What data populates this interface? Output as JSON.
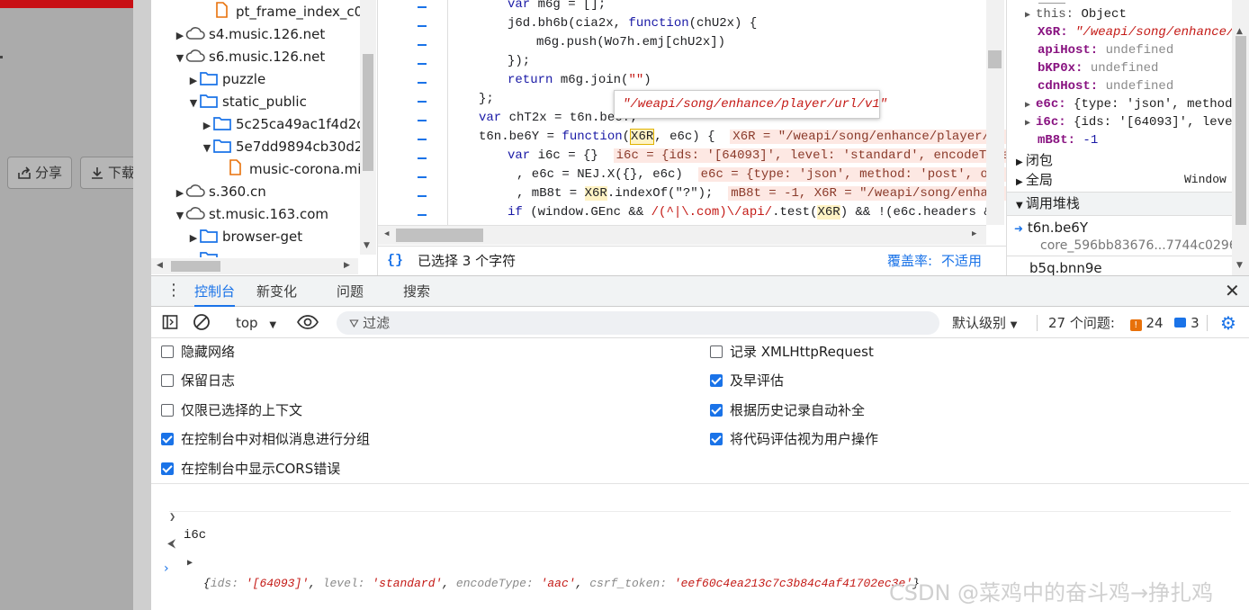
{
  "page": {
    "share_label": "分享",
    "download_label": "下载"
  },
  "tree": {
    "items": [
      {
        "label": "pt_frame_index_c0",
        "kind": "file",
        "expanded": false
      },
      {
        "label": "s4.music.126.net",
        "kind": "domain",
        "expanded": false
      },
      {
        "label": "s6.music.126.net",
        "kind": "domain",
        "expanded": true
      },
      {
        "label": "puzzle",
        "kind": "folder",
        "expanded": false
      },
      {
        "label": "static_public",
        "kind": "folder",
        "expanded": true
      },
      {
        "label": "5c25ca49ac1f4d2d",
        "kind": "folder",
        "expanded": false
      },
      {
        "label": "5e7dd9894cb30d2",
        "kind": "folder",
        "expanded": true
      },
      {
        "label": "music-corona.mi",
        "kind": "file",
        "expanded": false
      },
      {
        "label": "s.360.cn",
        "kind": "domain",
        "expanded": false
      },
      {
        "label": "st.music.163.com",
        "kind": "domain",
        "expanded": true
      },
      {
        "label": "browser-get",
        "kind": "folder",
        "expanded": false
      },
      {
        "label": "...",
        "kind": "folder",
        "expanded": false
      }
    ]
  },
  "code": {
    "tooltip": "\"/weapi/song/enhance/player/url/v1\"",
    "lines": {
      "l1a": "var ",
      "l1b": "m6g = [];",
      "l2a": "j6d.bh6b(cia2x, ",
      "l2b": "function",
      "l2c": "(chU2x) {",
      "l3": "m6g.push(Wo7h.emj[chU2x])",
      "l4": "});",
      "l5a": "return ",
      "l5b": "m6g.join(",
      "l5c": "\"\"",
      "l5d": ")",
      "l6": "};",
      "l7a": "var ",
      "l7b": "chT2x = t6n.be6Y;",
      "l8a": "t6n.be6Y = ",
      "l8b": "function",
      "l8c": "(",
      "l8d": "X6R",
      "l8e": ", e6c) {",
      "l8f": "X6R = \"/weapi/song/enhance/player/url",
      "l9a": "var ",
      "l9b": "i6c = {}",
      "l9c": "i6c = {ids: '[64093]', level: 'standard', encodeType",
      "l10a": ", e6c = NEJ.X({}, e6c)",
      "l10b": "e6c = {type: 'json', method: 'post', onl",
      "l11a": ", mB8t = ",
      "l11b": "X6R",
      "l11c": ".indexOf(\"?\");",
      "l11d": "mB8t = -1, X6R = \"/weapi/song/enhanc",
      "l12a": "if ",
      "l12b": "(window.GEnc && ",
      "l12c": "/(^|\\.com)\\/api/",
      "l12d": ".test(",
      "l12e": "X6R",
      "l12f": ") && !(e6c.headers && e"
    },
    "status_text": "已选择 3 个字符",
    "coverage_label": "覆盖率:",
    "coverage_value": "不适用"
  },
  "scope": {
    "rows": {
      "this_key": "this:",
      "this_val": "Object",
      "x6r_key": "X6R:",
      "x6r_val": "\"/weapi/song/enhance/p",
      "api_key": "apiHost:",
      "api_val": "undefined",
      "bkp_key": "bKP0x:",
      "bkp_val": "undefined",
      "cdn_key": "cdnHost:",
      "cdn_val": "undefined",
      "e6c_key": "e6c:",
      "e6c_val": "{type: 'json', method:",
      "i6c_key": "i6c:",
      "i6c_val": "{ids: '[64093]', level",
      "mb8_key": "mB8t:",
      "mb8_val": "-1"
    },
    "closure_label": "闭包",
    "global_label": "全局",
    "global_value": "Window",
    "callstack_label": "调用堆栈",
    "frame1_name": "t6n.be6Y",
    "frame1_file": "core_596bb83676...7744c0296",
    "frame2_name": "b5q.bnn9e"
  },
  "drawer": {
    "tabs": [
      "控制台",
      "新变化",
      "问题",
      "搜索"
    ],
    "context": "top",
    "filter_placeholder": "过滤",
    "levels_label": "默认级别",
    "issues_label": "27 个问题:",
    "warn_count": "24",
    "info_count": "3",
    "options_left": [
      {
        "label": "隐藏网络",
        "checked": false
      },
      {
        "label": "保留日志",
        "checked": false
      },
      {
        "label": "仅限已选择的上下文",
        "checked": false
      },
      {
        "label": "在控制台中对相似消息进行分组",
        "checked": true
      },
      {
        "label": "在控制台中显示CORS错误",
        "checked": true
      }
    ],
    "options_right": [
      {
        "label": "记录 XMLHttpRequest",
        "checked": false
      },
      {
        "label": "及早评估",
        "checked": true
      },
      {
        "label": "根据历史记录自动补全",
        "checked": true
      },
      {
        "label": "将代码评估视为用户操作",
        "checked": true
      }
    ],
    "console": {
      "input_cmd": "i6c",
      "out_open": "{",
      "k1": "ids:",
      "v1": "'[64093]'",
      "k2": "level:",
      "v2": "'standard'",
      "k3": "encodeType:",
      "v3": "'aac'",
      "k4": "csrf_token:",
      "v4": "'eef60c4ea213c7c3b84c4af41702ec3e'",
      "out_close": "}",
      "sep": ", "
    }
  },
  "watermark": "CSDN @菜鸡中的奋斗鸡→挣扎鸡",
  "colors": {
    "accent": "#1a73e8",
    "keyword": "#1a1aa6",
    "string": "#c41a16",
    "prop": "#881280",
    "page_red": "#c80f14"
  }
}
